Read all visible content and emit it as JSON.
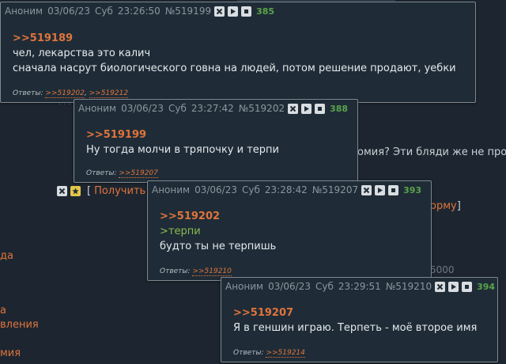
{
  "background": {
    "line1": "омия? Эти бляди же не про",
    "line2_bracket": "[",
    "line2_link": "Получить",
    "line3": "орму",
    "line3_bracket": "]",
    "number_5000": "5000",
    "left_items": [
      "да",
      "а",
      "вления",
      "мия"
    ],
    "dots": "· · ·"
  },
  "colors": {
    "link": "#e0743b",
    "greentext": "#8cb94f",
    "counter": "#5aa34a",
    "panel": "#1f2c37"
  },
  "posts": [
    {
      "author": "Аноним",
      "date": "03/06/23",
      "day": "Суб",
      "time": "23:26:50",
      "num": "№519199",
      "counter": "385",
      "reply_to": ">>519189",
      "lines": [
        "чел, лекарства это калич",
        "сначала насрут биологического говна на людей, потом решение продают, уебки"
      ],
      "answers_label": "Ответы:",
      "answers": [
        ">>519202",
        ">>519212"
      ]
    },
    {
      "author": "Аноним",
      "date": "03/06/23",
      "day": "Суб",
      "time": "23:27:42",
      "num": "№519202",
      "counter": "388",
      "reply_to": ">>519199",
      "lines": [
        "Ну тогда молчи в тряпочку и терпи"
      ],
      "answers_label": "Ответы:",
      "answers": [
        ">>519207"
      ]
    },
    {
      "author": "Аноним",
      "date": "03/06/23",
      "day": "Суб",
      "time": "23:28:42",
      "num": "№519207",
      "counter": "393",
      "reply_to": ">>519202",
      "greentext": ">терпи",
      "lines": [
        "будто ты не терпишь"
      ],
      "answers_label": "Ответы:",
      "answers": [
        ">>519210"
      ]
    },
    {
      "author": "Аноним",
      "date": "03/06/23",
      "day": "Суб",
      "time": "23:29:51",
      "num": "№519210",
      "counter": "394",
      "reply_to": ">>519207",
      "lines": [
        "Я в геншин играю. Терпеть - моё второе имя"
      ],
      "answers_label": "Ответы:",
      "answers": [
        ">>519214"
      ]
    }
  ]
}
